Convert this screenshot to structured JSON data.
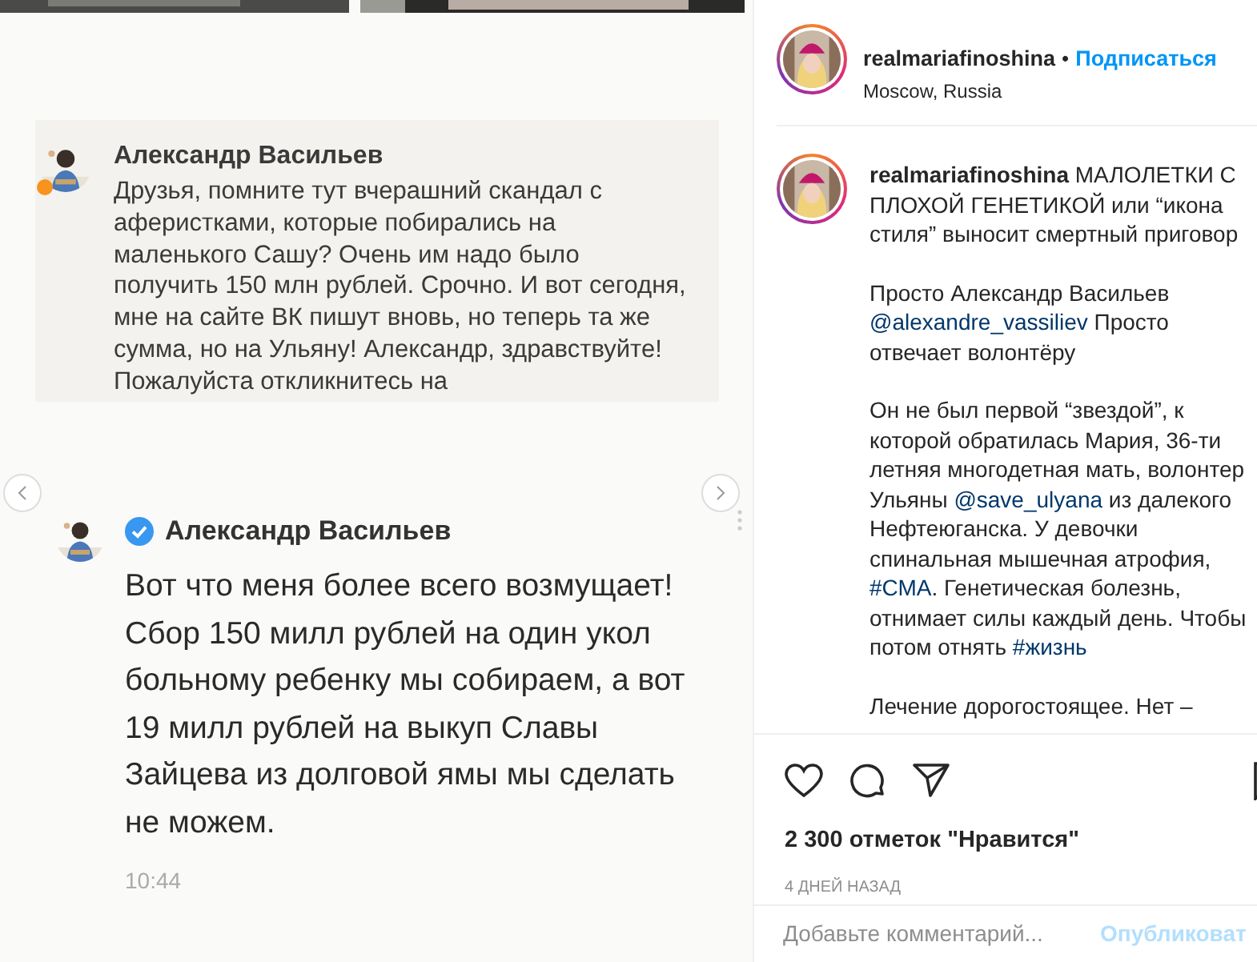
{
  "post": {
    "image": {
      "quote": {
        "author": "Александр Васильев",
        "status_dot": true,
        "text": "Друзья, помните тут вчерашний скандал с аферистками, которые побирались на маленького Сашу? Очень им надо было получить 150 млн рублей. Срочно. И вот сегодня, мне на сайте ВК пишут вновь, но теперь та же сумма, но на Ульяну! Александр, здравствуйте! Пожалуйста откликнитесь на"
      },
      "reply": {
        "author": "Александр Васильев",
        "verified": true,
        "text": "Вот что меня более всего возмущает! Сбор 150 милл рублей на один укол больному ребенку мы собираем, а вот 19 милл рублей на выкуп Славы Зайцева из долговой ямы мы сделать не можем.",
        "time": "10:44"
      }
    },
    "header": {
      "username": "realmariafinoshina",
      "separator": "•",
      "follow": "Подписаться",
      "location": "Moscow, Russia"
    },
    "caption": [
      [
        {
          "kind": "username",
          "text": "realmariafinoshina"
        },
        {
          "kind": "text",
          "text": " МАЛОЛЕТКИ С ПЛОХОЙ ГЕНЕТИКОЙ или “икона стиля” выносит смертный приговор"
        }
      ],
      [
        {
          "kind": "text",
          "text": "Просто Александр Васильев "
        },
        {
          "kind": "link",
          "text": "@alexandre_vassiliev"
        },
        {
          "kind": "text",
          "text": " Просто отвечает волонтёру"
        }
      ],
      [
        {
          "kind": "text",
          "text": "Он не был первой “звездой”, к которой обратилась Мария, 36-ти летняя многодетная мать, волонтер Ульяны "
        },
        {
          "kind": "link",
          "text": "@save_ulyana"
        },
        {
          "kind": "text",
          "text": " из далекого Нефтеюганска. У девочки спинальная мышечная атрофия, "
        },
        {
          "kind": "link",
          "text": "#СМА"
        },
        {
          "kind": "text",
          "text": ". Генетическая болезнь, отнимает силы каждый день. Чтобы потом отнять "
        },
        {
          "kind": "link",
          "text": "#жизнь"
        }
      ],
      [
        {
          "kind": "text",
          "text": "Лечение дорогостоящее. Нет –"
        }
      ]
    ],
    "likes": "2 300 отметок \"Нравится\"",
    "date": "4 ДНЕЙ НАЗАД",
    "comment": {
      "placeholder": "Добавьте комментарий...",
      "submit": "Опубликоват"
    }
  }
}
